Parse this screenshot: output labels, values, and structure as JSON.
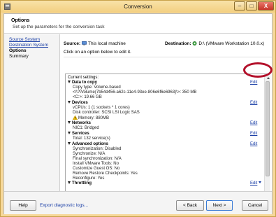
{
  "window": {
    "title": "Conversion",
    "app_icon": "vmware-icon",
    "controls": {
      "minimize": "–",
      "maximize": "□",
      "close": "X"
    },
    "colors": {
      "title_bar": "#f3cf80",
      "link": "#1a3ea6",
      "highlight_ring": "#b3102a"
    }
  },
  "header": {
    "title": "Options",
    "subtitle": "Set up the parameters for the conversion task"
  },
  "nav": {
    "items": [
      {
        "label": "Source System",
        "state": "link"
      },
      {
        "label": "Destination System",
        "state": "link"
      },
      {
        "label": "Options",
        "state": "current"
      },
      {
        "label": "Summary",
        "state": "plain"
      }
    ]
  },
  "main": {
    "source_label": "Source:",
    "source_value": "This local machine",
    "destination_label": "Destination:",
    "destination_value": "D:\\ (VMware Workstation 10.0.x)",
    "hint": "Click on an option below to edit it."
  },
  "settings": {
    "current_label": "Current settings:",
    "edit_label": "Edit",
    "sections": [
      {
        "title": "Data to copy",
        "lines": [
          "Copy type: Volume-based",
          "<\\\\?\\Volume{7b54d456-a62c-11e4-93ee-806e6f6e6963}\\>: 350 MB",
          "<C:>: 19.66 GB"
        ]
      },
      {
        "title": "Devices",
        "lines": [
          "vCPUs: 1 (1 sockets * 1 cores)",
          "Disk controller: SCSI LSI Logic SAS",
          "Memory: 880MB"
        ]
      },
      {
        "title": "Networks",
        "lines": [
          "NIC1: Bridged"
        ]
      },
      {
        "title": "Services",
        "lines": [
          "Total: 132 service(s)"
        ]
      },
      {
        "title": "Advanced options",
        "lines": [
          "Synchronization: Disabled",
          "Synchronize: N/A",
          "Final synchronization: N/A",
          "Install VMware Tools: No",
          "Customize Guest OS: No",
          "Remove Restore Checkpoints: Yes",
          "Reconfigure: Yes"
        ]
      },
      {
        "title": "Throttling",
        "lines": []
      }
    ]
  },
  "footer": {
    "help": "Help",
    "export": "Export diagnostic logs...",
    "back": "< Back",
    "next": "Next >",
    "cancel": "Cancel"
  }
}
